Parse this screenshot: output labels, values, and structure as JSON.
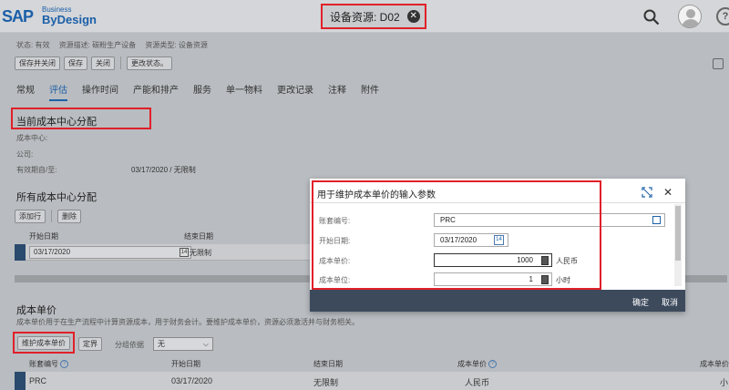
{
  "shell": {
    "logo_sap": "SAP",
    "logo_business": "Business",
    "logo_bydesign": "ByDesign",
    "title": "设备资源: D02",
    "close_glyph": "✕",
    "help_glyph": "?"
  },
  "info": {
    "status": "状态: 有效",
    "resource_desc": "资源描述: 碳粉生产设备",
    "resource_type": "资源类型: 设备资源"
  },
  "toolbar": {
    "save_close": "保存并关闭",
    "save": "保存",
    "close": "关闭",
    "change_status": "更改状态。"
  },
  "tabs": [
    "常规",
    "评估",
    "操作时间",
    "产能和排产",
    "服务",
    "单一物料",
    "更改记录",
    "注释",
    "附件"
  ],
  "current_cost_center": {
    "title": "当前成本中心分配",
    "cost_center_label": "成本中心:",
    "company_label": "公司:",
    "validity_label": "有效期自/至:",
    "validity_value": "03/17/2020 / 无限制"
  },
  "all_cost_center": {
    "title": "所有成本中心分配",
    "add_row": "添加行",
    "delete": "删除",
    "columns": [
      "开始日期",
      "结束日期"
    ],
    "row": {
      "start": "03/17/2020",
      "end": "无限制"
    }
  },
  "cost_rate": {
    "title": "成本单价",
    "description": "成本单价用于在生产流程中计算资源成本，用于财务会计。要维护成本单价，资源必须激活并与财务相关。",
    "maintain_button": "维护成本单价",
    "boundary_button": "定界",
    "group_label": "分组依据",
    "group_value": "无",
    "columns": [
      "账套编号",
      "开始日期",
      "结束日期",
      "成本单价",
      "成本单价"
    ],
    "row": {
      "set": "PRC",
      "start": "03/17/2020",
      "end": "无限制",
      "currency": "人民币",
      "last": "小"
    }
  },
  "dialog": {
    "title": "用于维护成本单价的输入参数",
    "fields": [
      {
        "label": "账套编号:",
        "value": "PRC"
      },
      {
        "label": "开始日期:",
        "value": "03/17/2020"
      },
      {
        "label": "成本单价:",
        "value": "1000",
        "unit": "人民币"
      },
      {
        "label": "成本单位:",
        "value": "1",
        "unit": "小时"
      }
    ],
    "calendar_glyph": "14",
    "ok": "确定",
    "cancel": "取消"
  }
}
